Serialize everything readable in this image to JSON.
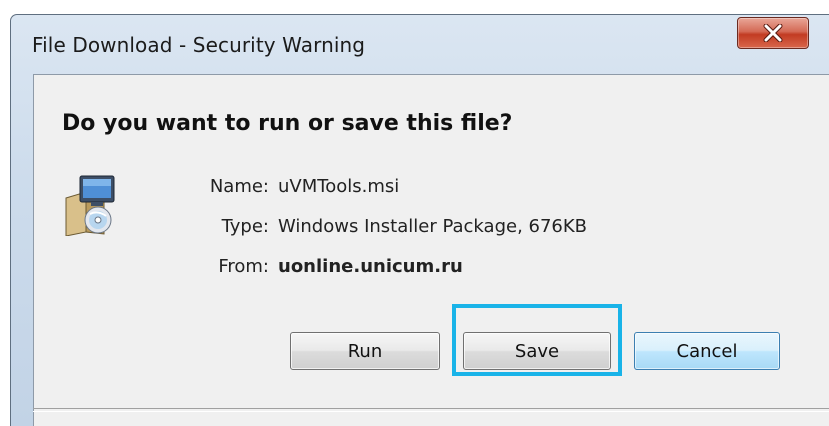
{
  "window": {
    "title": "File Download - Security Warning",
    "close_icon": "close-x-icon"
  },
  "dialog": {
    "question": "Do you want to run or save this file?",
    "file_icon": "installer-package-icon",
    "fields": [
      {
        "label": "Name:",
        "value": "uVMTools.msi"
      },
      {
        "label": "Type:",
        "value": "Windows Installer Package, 676KB"
      },
      {
        "label": "From:",
        "value": "uonline.unicum.ru"
      }
    ]
  },
  "buttons": {
    "run": "Run",
    "save": "Save",
    "cancel": "Cancel"
  },
  "colors": {
    "highlight": "#19b3e8",
    "close_button": "#c23b22",
    "default_button_border": "#3c7fb1"
  }
}
